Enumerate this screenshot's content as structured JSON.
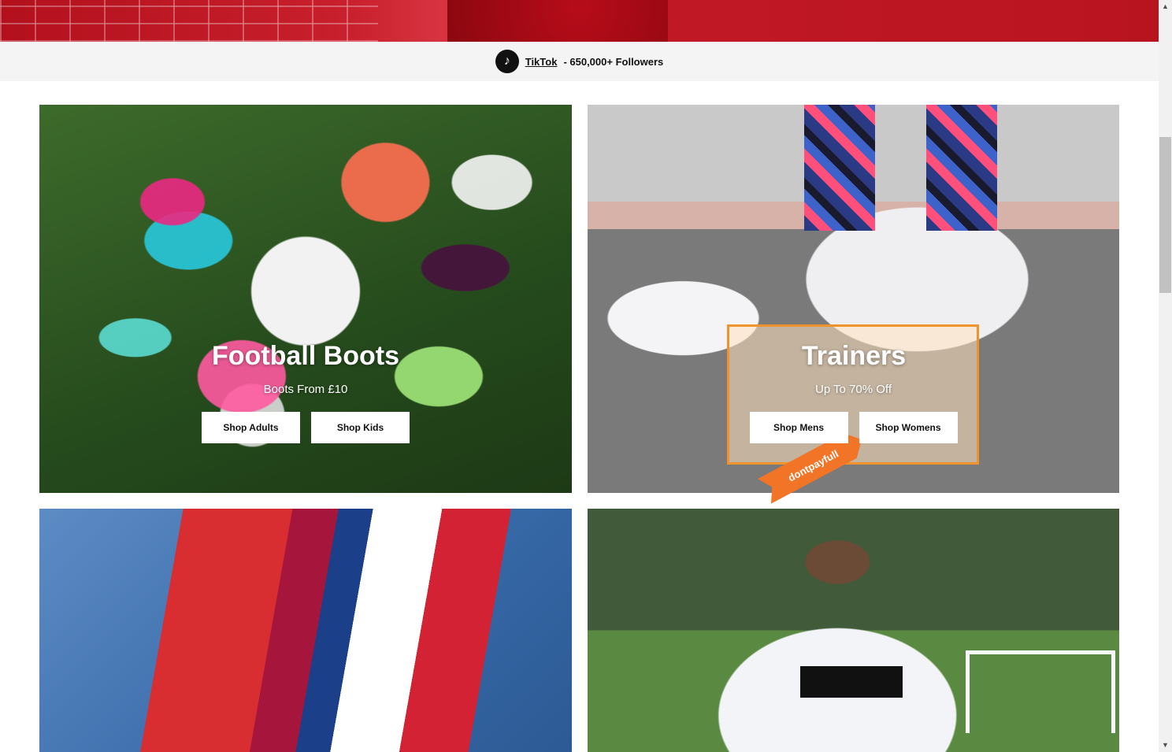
{
  "social": {
    "platform": "TikTok",
    "followers_text": "- 650,000+ Followers",
    "icon": "tiktok-icon"
  },
  "tiles": [
    {
      "title": "Football Boots",
      "subtitle": "Boots From £10",
      "buttons": [
        "Shop Adults",
        "Shop Kids"
      ]
    },
    {
      "title": "Trainers",
      "subtitle": "Up To 70% Off",
      "buttons": [
        "Shop Mens",
        "Shop Womens"
      ]
    }
  ],
  "highlight_tag": "dontpayfull",
  "colors": {
    "accent_orange": "#f0922d",
    "hero_red": "#c8202c"
  }
}
